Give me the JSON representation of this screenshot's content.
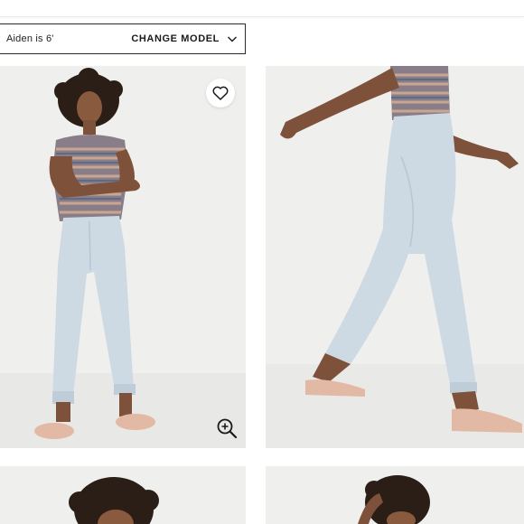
{
  "model_selector": {
    "model_text": "Aiden is 6'",
    "change_label": "CHANGE MODEL"
  },
  "icons": {
    "favorite": "heart-icon",
    "zoom": "zoom-in-icon",
    "dropdown": "chevron-down-icon"
  },
  "colors": {
    "background": "#ffffff",
    "photo_bg": "#ededeb",
    "border": "#2b2b2b",
    "denim": "#cdd9e3",
    "sandal": "#e2b9a4"
  }
}
